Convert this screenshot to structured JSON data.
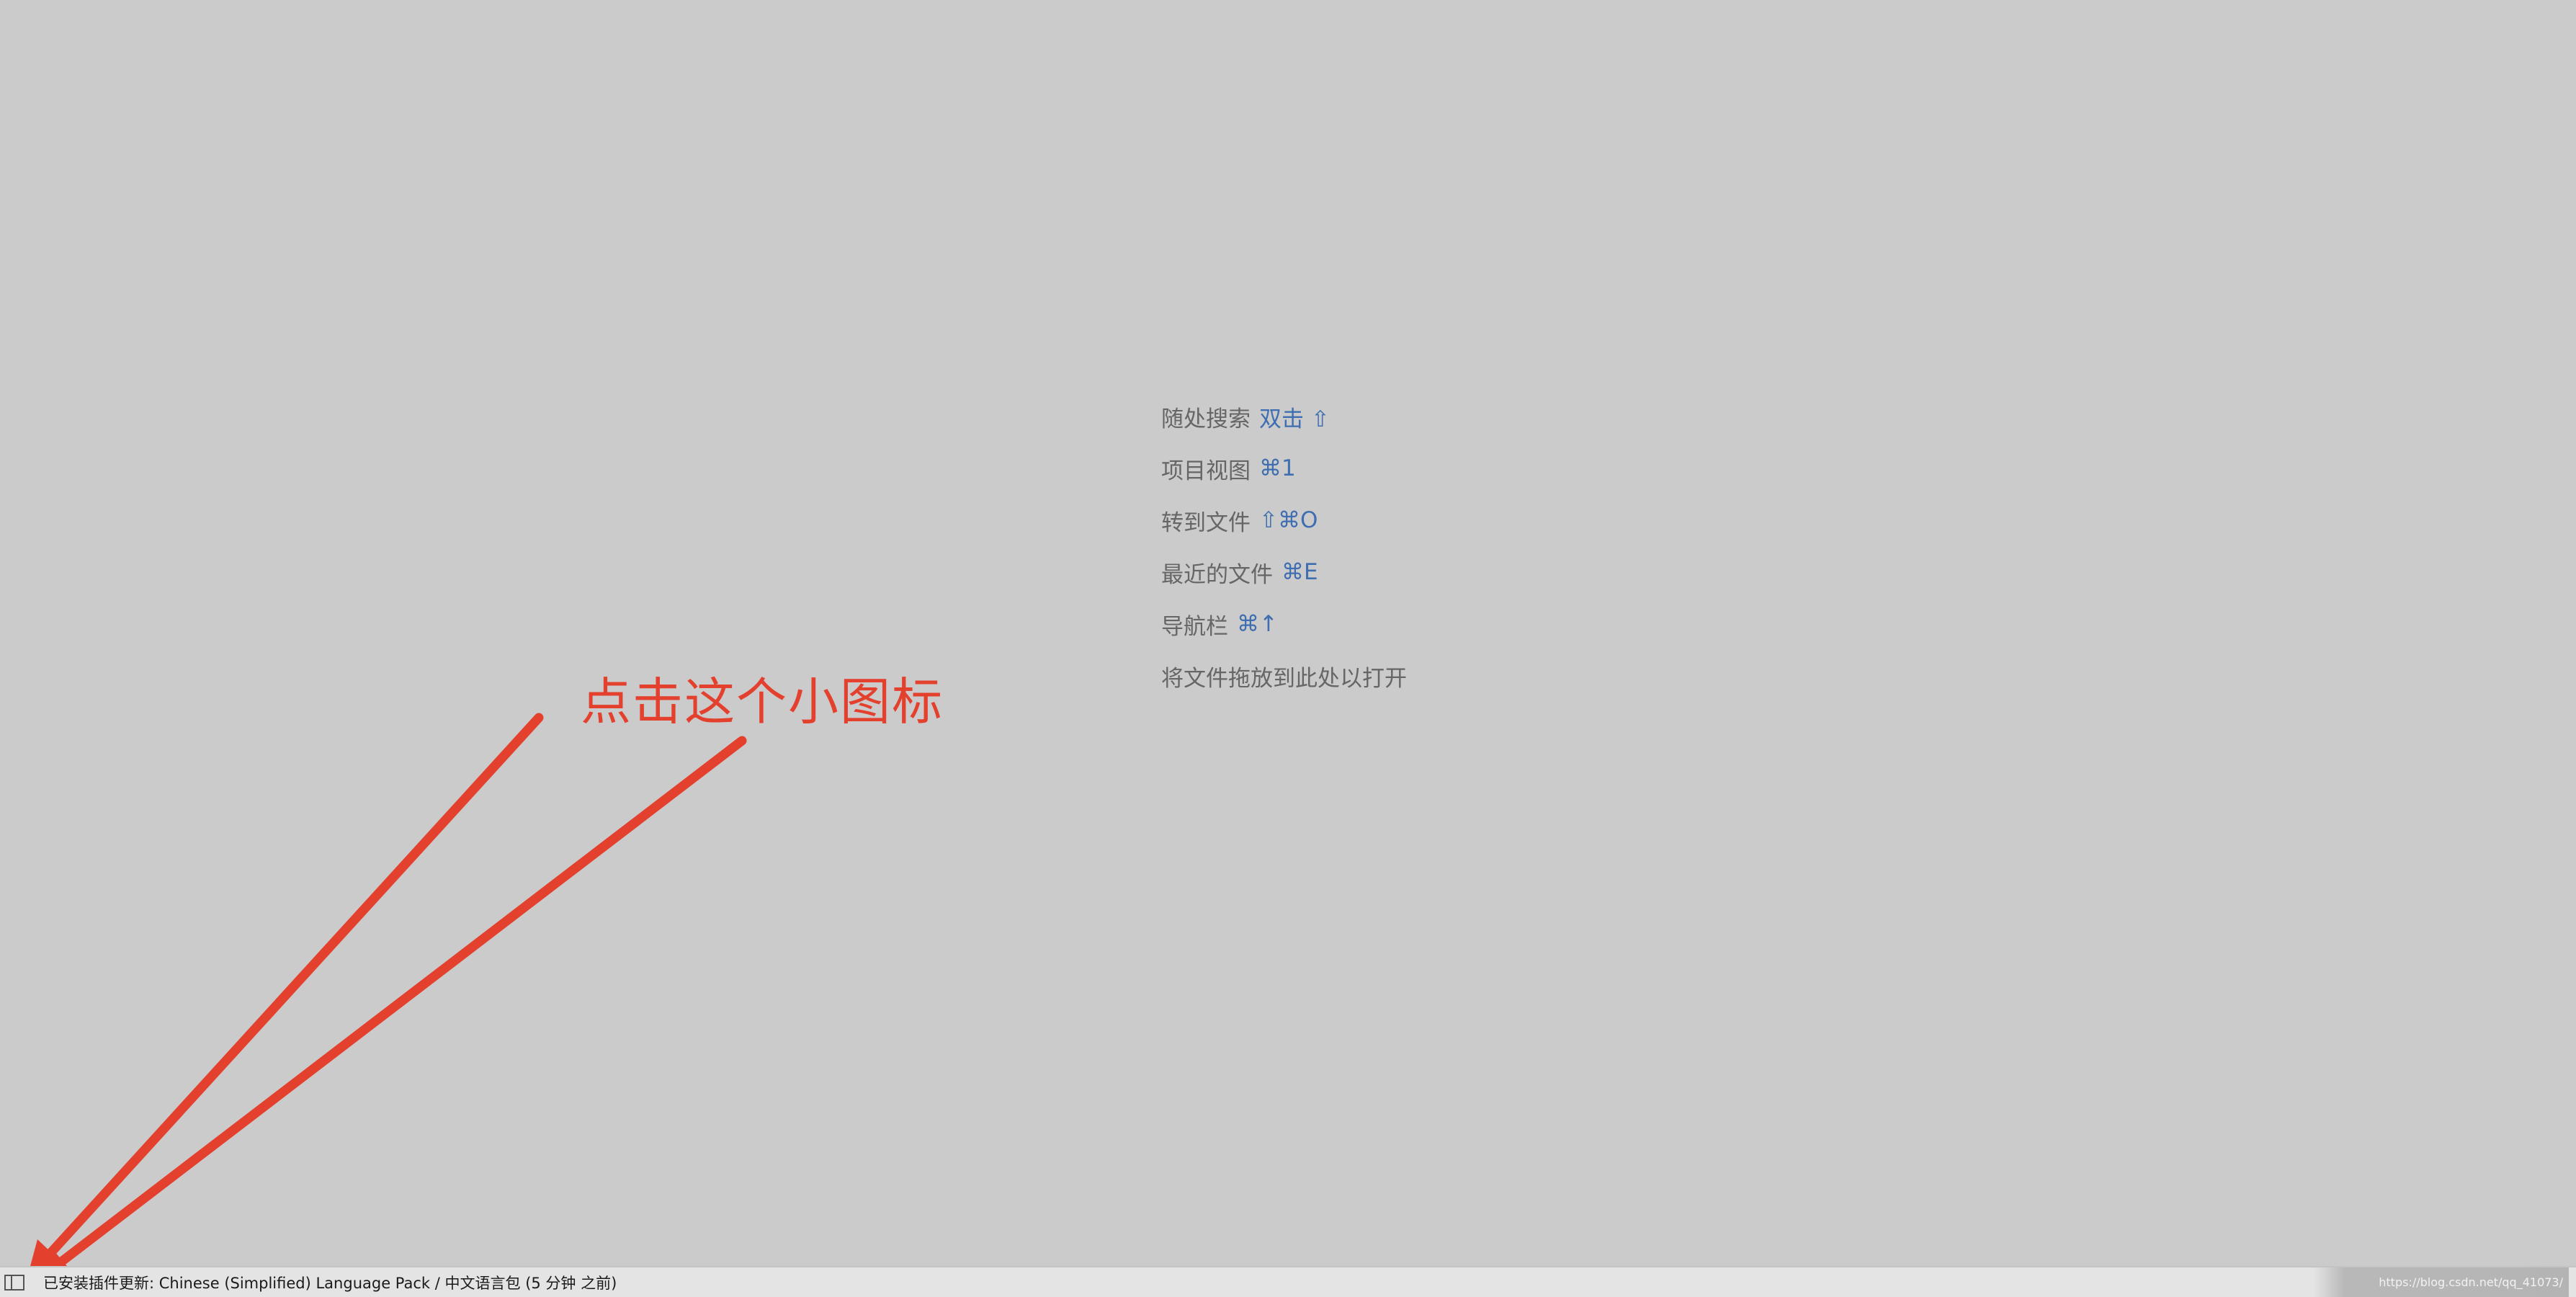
{
  "hints": [
    {
      "label": "随处搜索",
      "shortcut": "双击 ⇧"
    },
    {
      "label": "项目视图",
      "shortcut": "⌘1"
    },
    {
      "label": "转到文件",
      "shortcut": "⇧⌘O"
    },
    {
      "label": "最近的文件",
      "shortcut": "⌘E"
    },
    {
      "label": "导航栏",
      "shortcut": "⌘↑"
    },
    {
      "label": "将文件拖放到此处以打开",
      "shortcut": ""
    }
  ],
  "annotation": {
    "text": "点击这个小图标"
  },
  "status_bar": {
    "toggle_icon": "panel-toggle-icon",
    "message": "已安装插件更新: Chinese (Simplified) Language Pack / 中文语言包 (5 分钟 之前)",
    "watermark": "https://blog.csdn.net/qq_41073/"
  },
  "colors": {
    "background": "#cbcbcb",
    "hint_label": "#666666",
    "hint_shortcut": "#3f6fb0",
    "annotation": "#e3402e",
    "status_bar": "#e4e4e4"
  }
}
